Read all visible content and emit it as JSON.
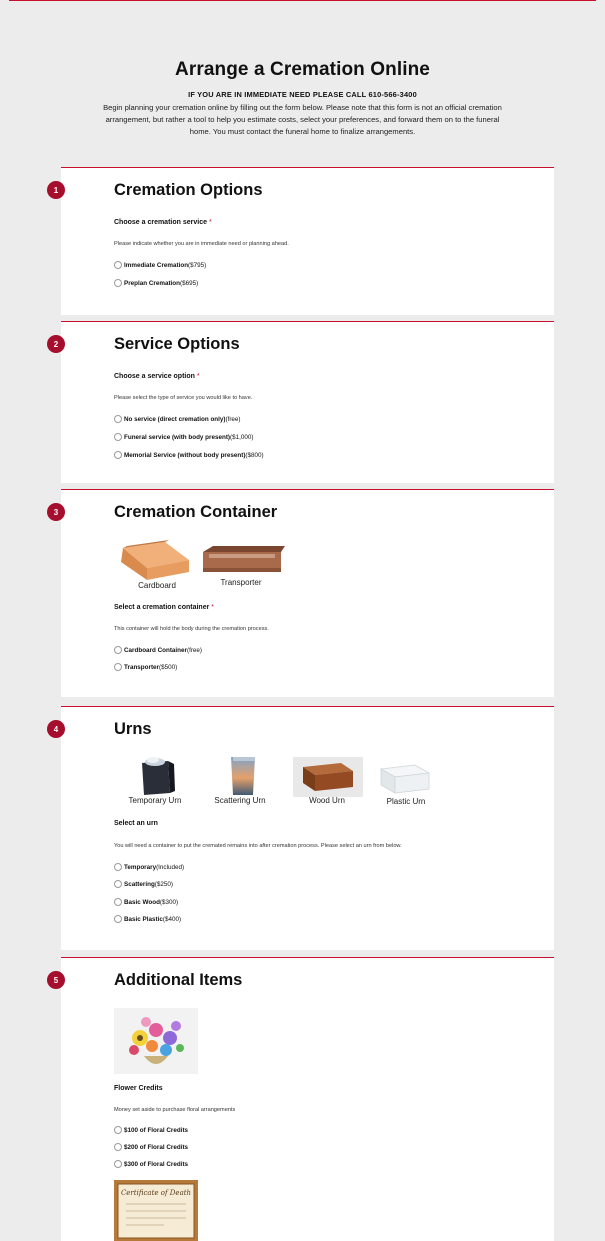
{
  "header": {
    "title": "Arrange a Cremation Online",
    "urgent": "IF YOU ARE IN IMMEDIATE NEED PLEASE CALL 610-566-3400",
    "intro": "Begin planning your cremation online by filling out the form below. Please note that this form is not an official cremation arrangement, but rather a tool to help you estimate costs, select your preferences, and forward them on to the funeral home. You must contact the funeral home to finalize arrangements."
  },
  "colors": {
    "accent": "#c8102e",
    "badge": "#a50e2d",
    "background": "#ececec"
  },
  "sections": [
    {
      "number": "1",
      "title": "Cremation Options",
      "question": "Choose a cremation service",
      "required": "*",
      "helper": "Please indicate whether you are in immediate need or planning ahead.",
      "options": [
        {
          "name": "Immediate Cremation",
          "price": "($795)"
        },
        {
          "name": "Preplan Cremation",
          "price": "($695)"
        }
      ]
    },
    {
      "number": "2",
      "title": "Service Options",
      "question": "Choose a service option",
      "required": "*",
      "helper": "Please select the type of service you would like to have.",
      "options": [
        {
          "name": "No service (direct cremation only)",
          "price": "(free)"
        },
        {
          "name": "Funeral service (with body present)",
          "price": "($1,000)"
        },
        {
          "name": "Memorial Service (without body present)",
          "price": "($800)"
        }
      ]
    },
    {
      "number": "3",
      "title": "Cremation Container",
      "images": [
        {
          "caption": "Cardboard",
          "icon": "cardboard-box-icon"
        },
        {
          "caption": "Transporter",
          "icon": "transporter-container-icon"
        }
      ],
      "question": "Select a cremation container",
      "required": "*",
      "helper": "This container will hold the body during the cremation process.",
      "options": [
        {
          "name": "Cardboard Container",
          "price": "(free)"
        },
        {
          "name": "Transporter",
          "price": "($500)"
        }
      ]
    },
    {
      "number": "4",
      "title": "Urns",
      "images": [
        {
          "caption": "Temporary Urn",
          "icon": "temporary-urn-icon"
        },
        {
          "caption": "Scattering Urn",
          "icon": "scattering-urn-icon"
        },
        {
          "caption": "Wood Urn",
          "icon": "wood-urn-icon"
        },
        {
          "caption": "Plastic Urn",
          "icon": "plastic-urn-icon"
        }
      ],
      "question": "Select an urn",
      "helper": "You will need a container to put the cremated remains into after cremation process. Please select an urn from below.",
      "options": [
        {
          "name": "Temporary",
          "price": "(Included)"
        },
        {
          "name": "Scattering",
          "price": "($250)"
        },
        {
          "name": "Basic Wood",
          "price": "($300)"
        },
        {
          "name": "Basic Plastic",
          "price": "($400)"
        }
      ]
    },
    {
      "number": "5",
      "title": "Additional Items",
      "images": [
        {
          "icon": "flower-arrangement-icon"
        },
        {
          "icon": "death-certificate-icon",
          "seal_text": "Certificate of Death"
        }
      ],
      "question": "Flower Credits",
      "helper": "Money set aside to purchase floral arrangements",
      "options": [
        {
          "name": "$100 of Floral Credits",
          "price": ""
        },
        {
          "name": "$200 of Floral Credits",
          "price": ""
        },
        {
          "name": "$300 of Floral Credits",
          "price": ""
        }
      ]
    }
  ]
}
